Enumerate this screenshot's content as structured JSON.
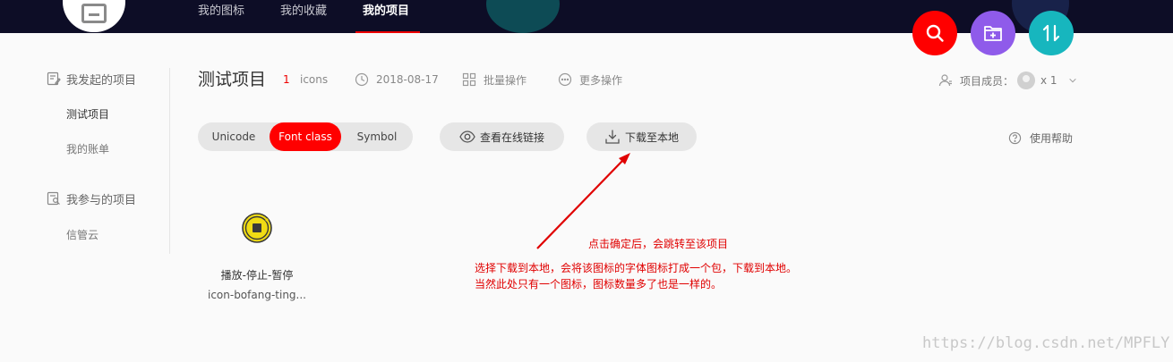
{
  "nav": {
    "links": [
      "我的图标",
      "我的收藏",
      "我的项目"
    ],
    "active": "我的项目"
  },
  "actions": {
    "search_icon": "search-icon",
    "new_project_icon": "folder-plus-icon",
    "upload_download_icon": "sort-arrows-icon",
    "colors": {
      "search": "#ff0000",
      "new_project": "#8f5bea",
      "upload_download": "#17b6be"
    }
  },
  "sidebar": {
    "created_heading": "我发起的项目",
    "created_items": [
      "测试项目",
      "我的账单"
    ],
    "joined_heading": "我参与的项目",
    "joined_items": [
      "信管云"
    ]
  },
  "project": {
    "title": "测试项目",
    "icon_count": "1",
    "icon_count_label": "icons",
    "date": "2018-08-17",
    "batch_ops": "批量操作",
    "more_ops": "更多操作",
    "members_label": "项目成员：",
    "members_count": "x 1"
  },
  "toolbar": {
    "modes": [
      "Unicode",
      "Font class",
      "Symbol"
    ],
    "active_mode": "Font class",
    "view_online_link": "查看在线链接",
    "download_local": "下载至本地",
    "help": "使用帮助"
  },
  "icons": [
    {
      "name": "播放-停止-暂停",
      "class_name": "icon-bofang-ting...",
      "color": "#f0dc14"
    }
  ],
  "annotations": {
    "line1": "点击确定后，会跳转至该项目",
    "line2": "选择下载到本地，会将该图标的字体图标打成一个包，下载到本地。",
    "line3": "当然此处只有一个图标，图标数量多了也是一样的。",
    "color": "#e00000"
  },
  "watermark": "https://blog.csdn.net/MPFLY"
}
